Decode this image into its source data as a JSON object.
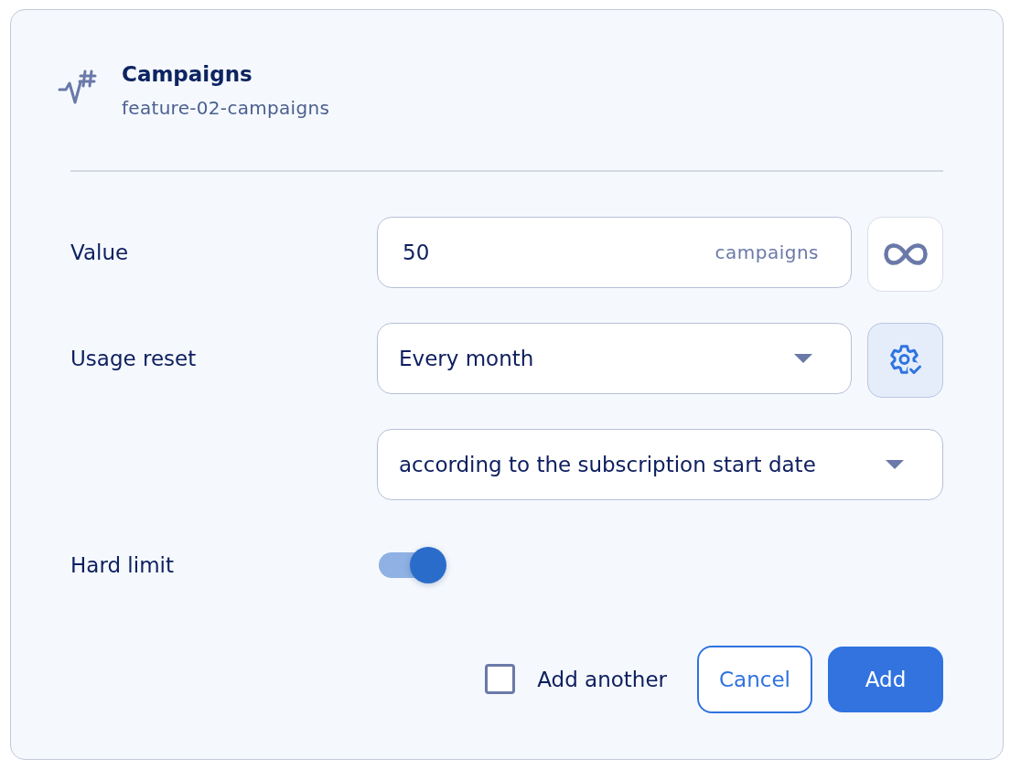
{
  "header": {
    "title": "Campaigns",
    "subtitle": "feature-02-campaigns"
  },
  "fields": [
    {
      "kind": "number",
      "label": "Value",
      "value": "50",
      "unit": "campaigns",
      "side_button": {
        "kind": "unlimited",
        "active": false
      }
    },
    {
      "kind": "select",
      "label": "Usage reset",
      "value": "Every month",
      "side_button": {
        "kind": "settings",
        "active": true
      }
    },
    {
      "kind": "select",
      "value": "according to the subscription start date"
    },
    {
      "kind": "toggle",
      "label": "Hard limit",
      "on": true
    }
  ],
  "footer": {
    "add_another": {
      "label": "Add another",
      "checked": false
    },
    "buttons": [
      {
        "label": "Cancel",
        "kind": "secondary"
      },
      {
        "label": "Add",
        "kind": "primary"
      }
    ]
  }
}
